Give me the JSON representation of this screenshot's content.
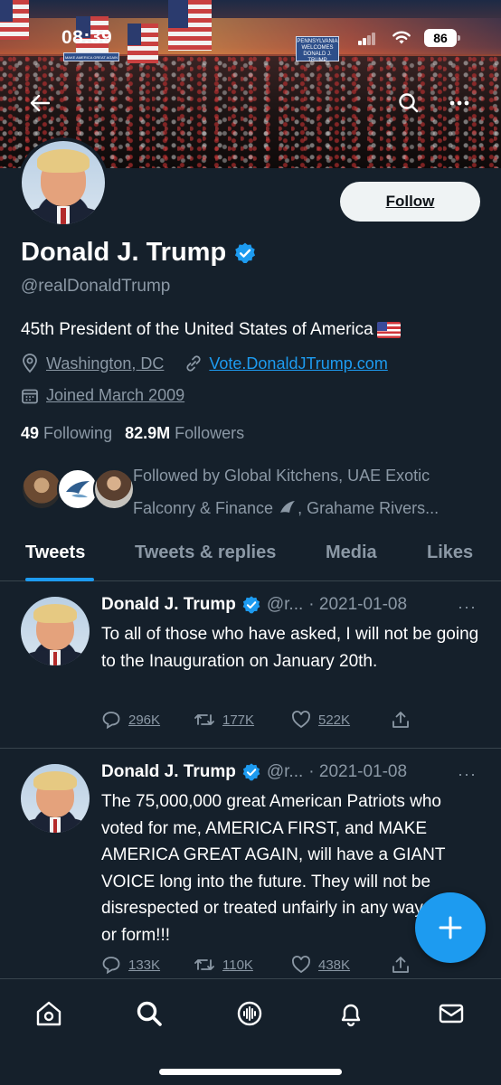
{
  "status_bar": {
    "time": "08:39",
    "battery": "86"
  },
  "banner": {
    "sign_text": "PENNSYLVANIA WELCOMES DONALD J. TRUMP",
    "banner_text": "MAKE AMERICA GREAT AGAIN"
  },
  "profile": {
    "name": "Donald J. Trump",
    "handle": "@realDonaldTrump",
    "follow_label": "Follow",
    "bio": "45th President of the United States of America",
    "location": "Washington, DC",
    "website": "Vote.DonaldJTrump.com",
    "joined": "Joined March 2009",
    "following_count": "49",
    "following_label": "Following",
    "followers_count": "82.9M",
    "followers_label": "Followers",
    "followed_by": "Followed by Global Kitchens, UAE Exotic Falconry & Finance",
    "followed_by_rest": ", Grahame Rivers..."
  },
  "tabs": [
    {
      "label": "Tweets",
      "active": true
    },
    {
      "label": "Tweets & replies",
      "active": false
    },
    {
      "label": "Media",
      "active": false
    },
    {
      "label": "Likes",
      "active": false
    }
  ],
  "tweets": [
    {
      "name": "Donald J. Trump",
      "handle": "@r...",
      "date": "· 2021-01-08",
      "more": "···",
      "text": "To all of those who have asked, I will not be going to the Inauguration on January 20th.",
      "replies": "296K",
      "retweets": "177K",
      "likes": "522K"
    },
    {
      "name": "Donald J. Trump",
      "handle": "@r...",
      "date": "· 2021-01-08",
      "more": "···",
      "text": "The 75,000,000 great American Patriots who voted for me, AMERICA FIRST, and MAKE AMERICA GREAT AGAIN, will have a GIANT VOICE long into the future. They will not be disrespected or treated unfairly in any way, shape or form!!!",
      "replies": "133K",
      "retweets": "110K",
      "likes": "438K"
    }
  ],
  "colors": {
    "accent": "#1d9bf0",
    "background": "#15202b",
    "muted": "#8b98a5",
    "divider": "#38444d"
  },
  "nav": [
    "home-icon",
    "search-icon",
    "spaces-icon",
    "notifications-icon",
    "messages-icon"
  ]
}
